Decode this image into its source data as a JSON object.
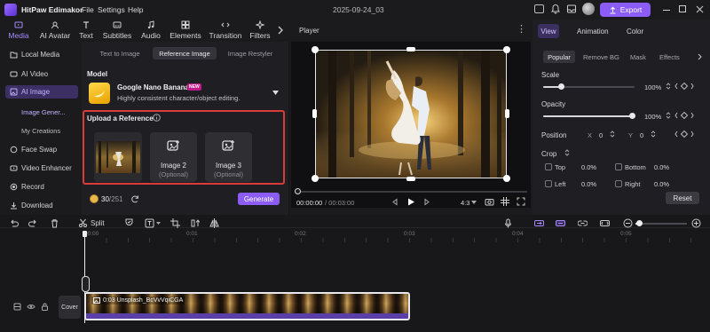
{
  "app": {
    "title": "HitPaw Edimakor",
    "menus": [
      "File",
      "Settings",
      "Help"
    ],
    "doc_date": "2025-09-24_03",
    "export_label": "Export"
  },
  "nav": {
    "items": [
      "Media",
      "AI Avatar",
      "Text",
      "Subtitles",
      "Audio",
      "Elements",
      "Transition",
      "Filters"
    ]
  },
  "left_nav": {
    "items": [
      "Local Media",
      "AI Video",
      "AI Image",
      "Face Swap",
      "Video Enhancer",
      "Record",
      "Download"
    ],
    "sub_items": [
      "Image Gener...",
      "My Creations"
    ]
  },
  "ai_panel": {
    "tabs": [
      "Text to Image",
      "Reference Image",
      "Image Restyler"
    ],
    "model_label": "Model",
    "model_name": "Google Nano Banana",
    "model_badge": "NEW",
    "model_desc": "Highly consistent character/object editing.",
    "upload_label": "Upload a Reference",
    "slot2_title": "Image 2",
    "slot2_sub": "(Optional)",
    "slot3_title": "Image 3",
    "slot3_sub": "(Optional)",
    "credits": "30",
    "credits_total": "/251",
    "generate_label": "Generate"
  },
  "player": {
    "title": "Player",
    "time_current": "00:00:00",
    "time_total": "/ 00:03:00",
    "ratio": "4:3"
  },
  "right": {
    "tabs": [
      "View",
      "Animation",
      "Color"
    ],
    "subtabs": [
      "Popular",
      "Remove BG",
      "Mask",
      "Effects"
    ],
    "scale_label": "Scale",
    "scale_value": "100%",
    "opacity_label": "Opacity",
    "opacity_value": "100%",
    "position_label": "Position",
    "pos_x_label": "X",
    "pos_x": "0",
    "pos_y_label": "Y",
    "pos_y": "0",
    "crop_label": "Crop",
    "crop_top": "Top",
    "crop_top_v": "0.0%",
    "crop_bottom": "Bottom",
    "crop_bottom_v": "0.0%",
    "crop_left": "Left",
    "crop_left_v": "0.0%",
    "crop_right": "Right",
    "crop_right_v": "0.0%",
    "reset_label": "Reset",
    "scale_fraction": 1.0,
    "opacity_fraction": 1.0
  },
  "timeline": {
    "split_label": "Split",
    "ruler": [
      "00:00",
      "0:01",
      "0:02",
      "0:03",
      "0:04",
      "0:05"
    ],
    "cover_label": "Cover",
    "clip_label": "0:03 Unsplash_BcVvVqiCGA"
  },
  "colors": {
    "accent": "#8b5cf6",
    "highlight": "#d93a3a",
    "clip": "#5b3fa8"
  }
}
